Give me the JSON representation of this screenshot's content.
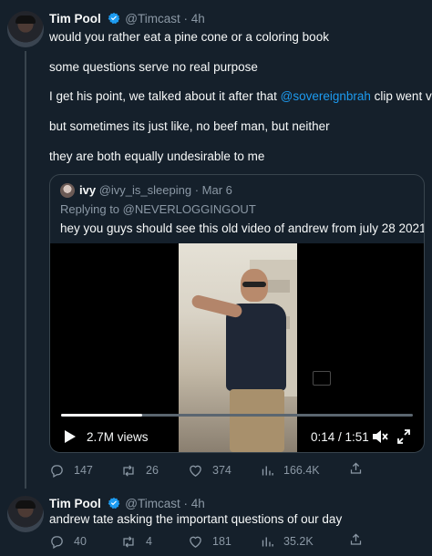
{
  "tweets": [
    {
      "author": {
        "name": "Tim Pool",
        "handle": "@Timcast",
        "time": "4h"
      },
      "lines": [
        "would you rather eat a pine cone or a coloring book",
        "some questions serve no real purpose",
        {
          "before": "I get his point, we talked about it after that ",
          "mention": "@sovereignbrah",
          "after": " clip went viral"
        },
        "but sometimes its just like, no beef man, but neither",
        "they are both equally undesirable to me"
      ],
      "quote": {
        "name": "ivy",
        "handle": "@ivy_is_sleeping",
        "time": "Mar 6",
        "replying_prefix": "Replying to ",
        "replying_to": "@NEVERLOGGINGOUT",
        "text": "hey you guys should see this old video of andrew from july 28 2021",
        "video": {
          "views": "2.7M views",
          "time": "0:14 / 1:51",
          "progress": 0.23
        }
      },
      "actions": {
        "replies": "147",
        "retweets": "26",
        "likes": "374",
        "views": "166.4K"
      }
    },
    {
      "author": {
        "name": "Tim Pool",
        "handle": "@Timcast",
        "time": "4h"
      },
      "text": "andrew tate asking the important questions of our day",
      "actions": {
        "replies": "40",
        "retweets": "4",
        "likes": "181",
        "views": "35.2K"
      }
    }
  ],
  "colors": {
    "background": "#15202b",
    "text": "#f7f9f9",
    "muted": "#8b98a5",
    "accent": "#1d9bf0",
    "border": "#38444d"
  }
}
